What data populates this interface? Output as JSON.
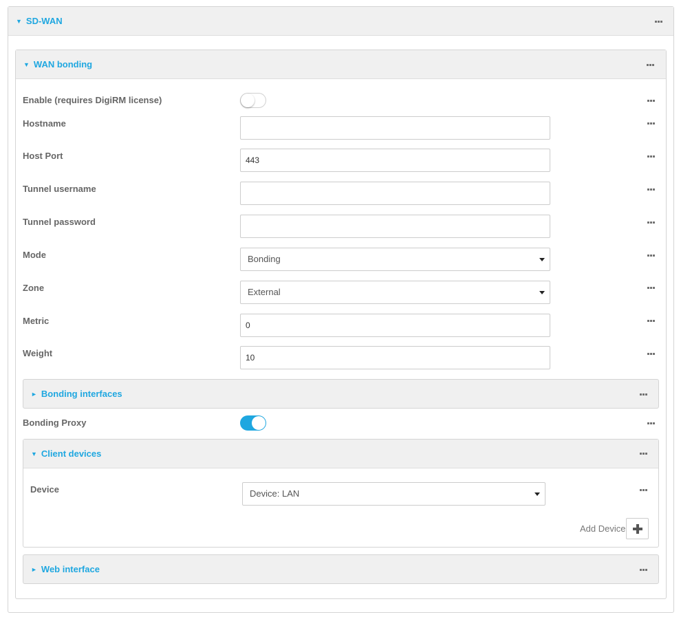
{
  "sdwan": {
    "title": "SD-WAN",
    "icon": "triangle-down-icon"
  },
  "wan_bonding": {
    "title": "WAN bonding",
    "icon": "triangle-down-icon",
    "enable": {
      "label": "Enable (requires DigiRM license)",
      "on": false
    },
    "hostname": {
      "label": "Hostname",
      "value": ""
    },
    "host_port": {
      "label": "Host Port",
      "value": "443"
    },
    "tunnel_username": {
      "label": "Tunnel username",
      "value": ""
    },
    "tunnel_password": {
      "label": "Tunnel password",
      "value": ""
    },
    "mode": {
      "label": "Mode",
      "value": "Bonding"
    },
    "zone": {
      "label": "Zone",
      "value": "External"
    },
    "metric": {
      "label": "Metric",
      "value": "0"
    },
    "weight": {
      "label": "Weight",
      "value": "10"
    },
    "bonding_interfaces": {
      "title": "Bonding interfaces",
      "icon": "triangle-right-icon"
    },
    "bonding_proxy": {
      "label": "Bonding Proxy",
      "on": true
    },
    "client_devices": {
      "title": "Client devices",
      "icon": "triangle-down-icon",
      "device": {
        "label": "Device",
        "value": "Device: LAN"
      },
      "add_device_label": "Add Device"
    },
    "web_interface": {
      "title": "Web interface",
      "icon": "triangle-right-icon"
    }
  },
  "colors": {
    "accent": "#1fa7e0",
    "header_bg": "#f0f0f0",
    "border": "#d4d4d4"
  }
}
